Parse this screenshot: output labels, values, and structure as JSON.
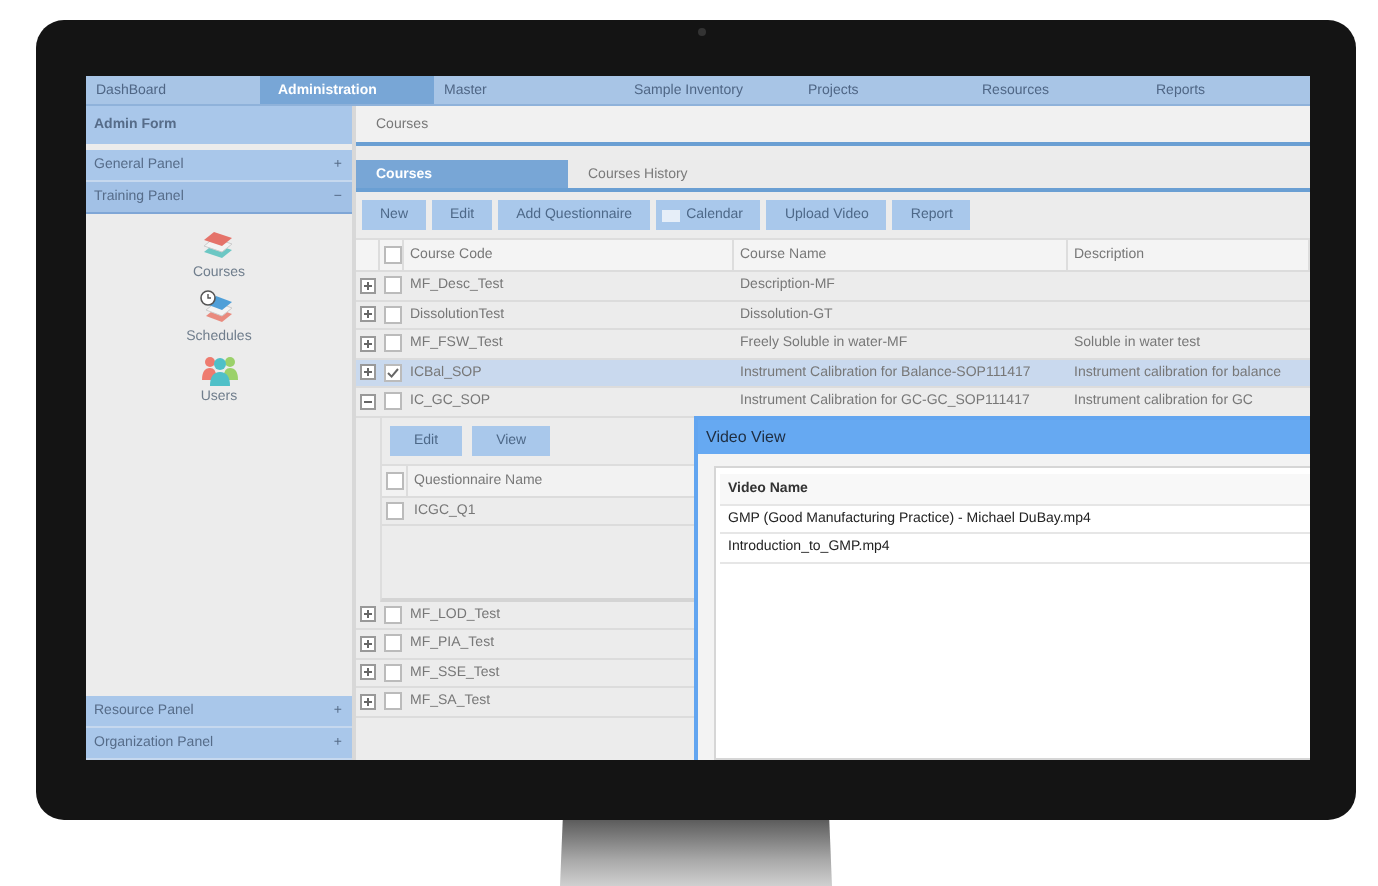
{
  "nav": {
    "tabs": [
      {
        "label": "DashBoard",
        "selected": false
      },
      {
        "label": "Administration",
        "selected": true
      },
      {
        "label": "Master",
        "selected": false
      },
      {
        "label": "Sample Inventory",
        "selected": false
      },
      {
        "label": "Projects",
        "selected": false
      },
      {
        "label": "Resources",
        "selected": false
      },
      {
        "label": "Reports",
        "selected": false
      }
    ]
  },
  "sidebar": {
    "header": "Admin Form",
    "panels": [
      {
        "title": "General Panel",
        "toggle": "+",
        "expanded": false
      },
      {
        "title": "Training Panel",
        "toggle": "−",
        "expanded": true,
        "items": [
          {
            "label": "Courses"
          },
          {
            "label": "Schedules"
          },
          {
            "label": "Users"
          }
        ]
      },
      {
        "title": "Resource Panel",
        "toggle": "+",
        "expanded": false
      },
      {
        "title": "Organization Panel",
        "toggle": "+",
        "expanded": false
      }
    ]
  },
  "main": {
    "breadcrumb": "Courses",
    "tabs": [
      {
        "label": "Courses",
        "selected": true
      },
      {
        "label": "Courses History",
        "selected": false
      }
    ],
    "toolbar": [
      {
        "label": "New",
        "kind": "plain"
      },
      {
        "label": "Edit",
        "kind": "plain"
      },
      {
        "label": "Add Questionnaire",
        "kind": "plain"
      },
      {
        "label": "Calendar",
        "kind": "calendar"
      },
      {
        "label": "Upload Video",
        "kind": "plain"
      },
      {
        "label": "Report",
        "kind": "plain"
      }
    ],
    "grid": {
      "columns": [
        "Course Code",
        "Course Name",
        "Description"
      ],
      "all_checked": false,
      "rows": [
        {
          "code": "MF_Desc_Test",
          "name": "Description-MF",
          "expanded": false,
          "checked": false,
          "selected": false
        },
        {
          "code": "DissolutionTest",
          "name": "Dissolution-GT",
          "expanded": false,
          "checked": false,
          "selected": false
        },
        {
          "code": "MF_FSW_Test",
          "name": "Freely Soluble in water-MF",
          "description": "Soluble in water test",
          "expanded": false,
          "checked": false,
          "selected": false
        },
        {
          "code": "ICBal_SOP",
          "name": "Instrument Calibration for Balance-SOP111417",
          "description": "Instrument calibration for balance",
          "expanded": false,
          "checked": true,
          "selected": true
        },
        {
          "code": "IC_GC_SOP",
          "name": "Instrument Calibration for GC-GC_SOP111417",
          "description": "Instrument calibration for GC",
          "expanded": true,
          "checked": false,
          "selected": false,
          "detail": {
            "buttons": [
              "Edit",
              "View"
            ],
            "columns": [
              "Questionnaire Name"
            ],
            "all_checked": false,
            "rows": [
              {
                "name": "ICGC_Q1",
                "checked": false
              }
            ]
          }
        },
        {
          "code": "MF_LOD_Test",
          "expanded": false,
          "checked": false,
          "selected": false
        },
        {
          "code": "MF_PIA_Test",
          "expanded": false,
          "checked": false,
          "selected": false
        },
        {
          "code": "MF_SSE_Test",
          "expanded": false,
          "checked": false,
          "selected": false
        },
        {
          "code": "MF_SA_Test",
          "expanded": false,
          "checked": false,
          "selected": false
        }
      ]
    }
  },
  "dialog": {
    "title": "Video View",
    "columns": [
      "Video Name"
    ],
    "rows": [
      "GMP (Good Manufacturing Practice) - Michael DuBay.mp4",
      "Introduction_to_GMP.mp4"
    ]
  }
}
